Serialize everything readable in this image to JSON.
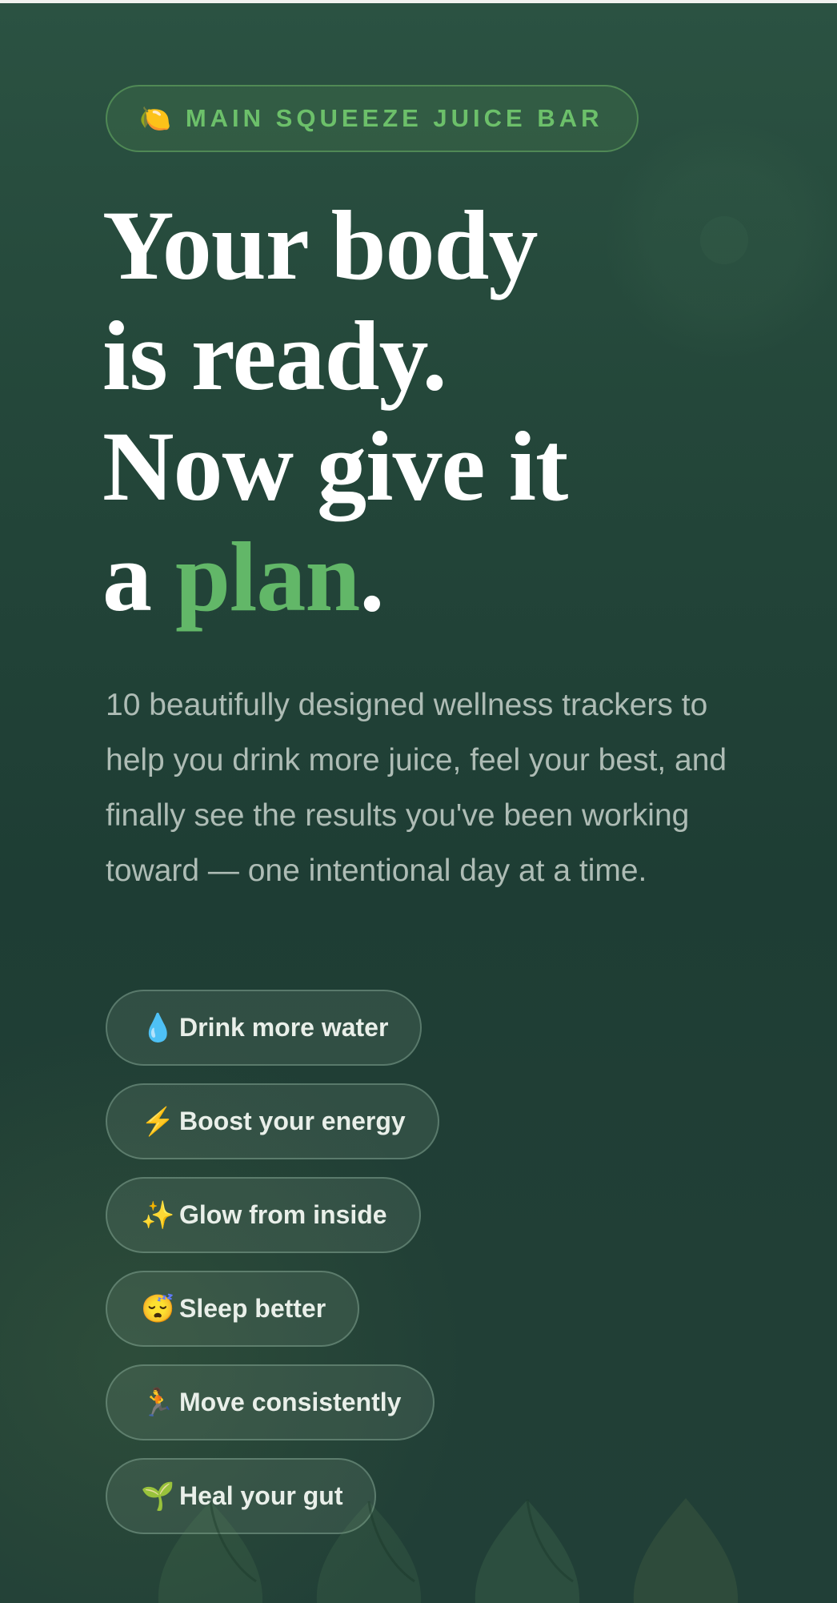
{
  "brand": {
    "icon": "lemon-icon",
    "name": "MAIN SQUEEZE JUICE BAR"
  },
  "hero": {
    "headline": {
      "line1": "Your body",
      "line2": "is ready.",
      "line3": "Now give it",
      "line4_prefix": "a",
      "line4_accent": "plan",
      "line4_suffix": "."
    },
    "subtitle": "10 beautifully designed wellness trackers to help you drink more juice, feel your best, and finally see the results you've been working toward — one intentional day at a time."
  },
  "benefits": [
    {
      "icon": "💧",
      "icon_name": "water-drop-icon",
      "label": "Drink more water"
    },
    {
      "icon": "⚡",
      "icon_name": "lightning-icon",
      "label": "Boost your energy"
    },
    {
      "icon": "✨",
      "icon_name": "sparkles-icon",
      "label": "Glow from inside"
    },
    {
      "icon": "😴",
      "icon_name": "sleeping-face-icon",
      "label": "Sleep better"
    },
    {
      "icon": "🏃",
      "icon_name": "runner-icon",
      "label": "Move consistently"
    },
    {
      "icon": "🌱",
      "icon_name": "seedling-icon",
      "label": "Heal your gut"
    }
  ],
  "colors": {
    "background": "#1e3d34",
    "accent": "#62b768",
    "eyebrow_text": "#6cc06a",
    "subtitle_text": "#aebcb5",
    "chip_text": "#e9efe9"
  }
}
